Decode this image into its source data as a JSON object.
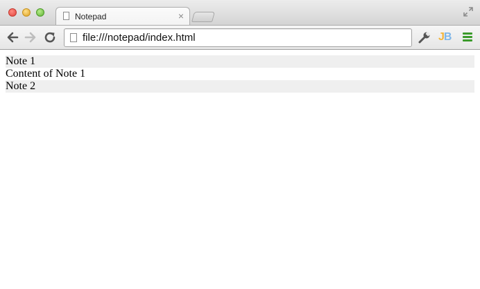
{
  "window": {
    "controls": [
      "close",
      "minimize",
      "zoom"
    ],
    "fullscreen_icon": "fullscreen-arrows-icon"
  },
  "tab": {
    "title": "Notepad",
    "icon": "page-icon",
    "close_glyph": "×"
  },
  "toolbar": {
    "back_icon": "back-arrow-icon",
    "forward_icon": "forward-arrow-icon",
    "reload_icon": "reload-icon",
    "address": "file:///notepad/index.html",
    "wrench_icon": "wrench-icon",
    "extension_label": "JB",
    "menu_icon": "menu-icon",
    "menu_color": "#3a9a2a"
  },
  "notes": [
    {
      "title": "Note 1",
      "content": "Content of Note 1"
    },
    {
      "title": "Note 2"
    }
  ],
  "colors": {
    "note_title_bg": "#efefef",
    "page_bg": "#ffffff"
  }
}
